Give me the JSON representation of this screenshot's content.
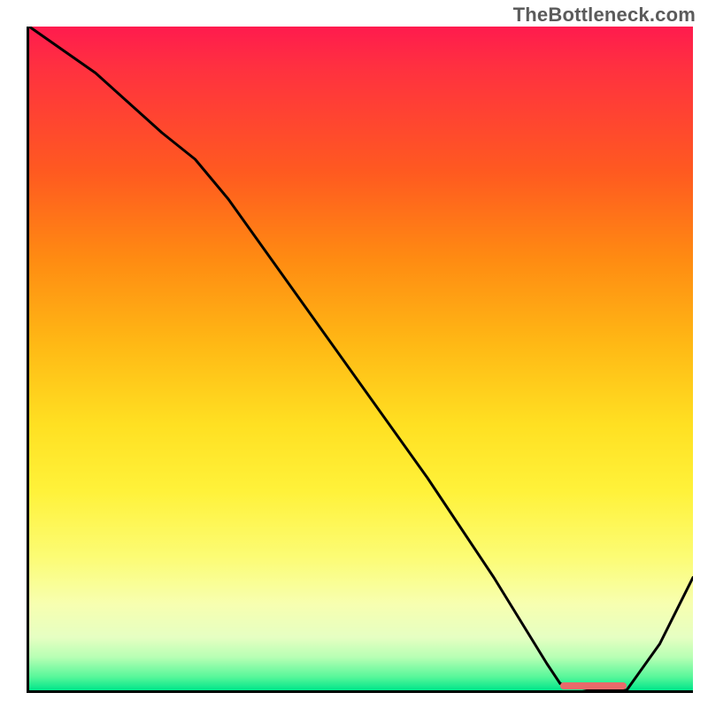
{
  "watermark": "TheBottleneck.com",
  "chart_data": {
    "type": "line",
    "title": "",
    "xlabel": "",
    "ylabel": "",
    "xlim": [
      0,
      100
    ],
    "ylim": [
      0,
      100
    ],
    "grid": false,
    "legend": false,
    "series": [
      {
        "name": "curve",
        "x": [
          0,
          10,
          20,
          25,
          30,
          40,
          50,
          60,
          70,
          78,
          80,
          85,
          90,
          95,
          100
        ],
        "values": [
          100,
          93,
          84,
          80,
          74,
          60,
          46,
          32,
          17,
          4,
          1,
          0,
          0,
          7,
          17
        ]
      }
    ],
    "marker": {
      "x_start": 80,
      "x_end": 90,
      "y": 0
    },
    "gradient_stops": [
      {
        "pos": 0,
        "color": "#ff1b4e"
      },
      {
        "pos": 22,
        "color": "#ff5a20"
      },
      {
        "pos": 48,
        "color": "#ffb915"
      },
      {
        "pos": 70,
        "color": "#fff23a"
      },
      {
        "pos": 92,
        "color": "#e6ffc2"
      },
      {
        "pos": 100,
        "color": "#00e58a"
      }
    ]
  }
}
